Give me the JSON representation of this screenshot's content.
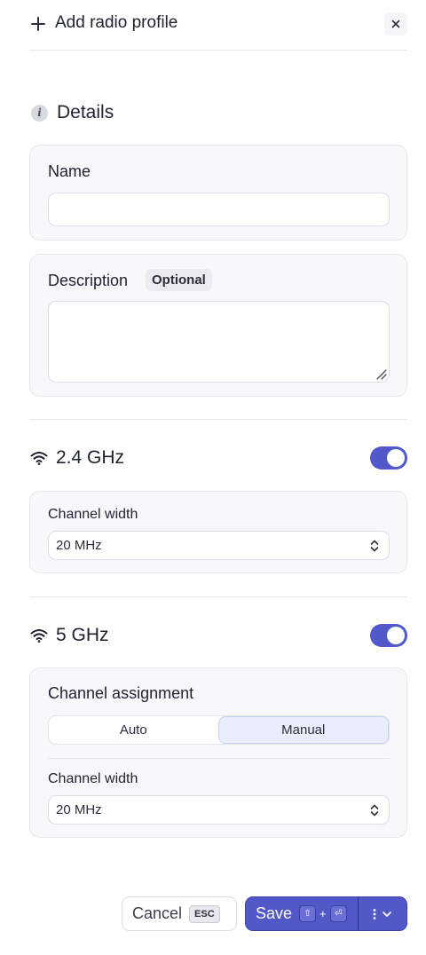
{
  "header": {
    "title": "Add radio profile"
  },
  "details": {
    "heading": "Details",
    "info_glyph": "i",
    "name_label": "Name",
    "name_value": "",
    "description_label": "Description",
    "optional_badge": "Optional",
    "description_value": ""
  },
  "band_24": {
    "heading": "2.4 GHz",
    "enabled": true,
    "channel_width_label": "Channel width",
    "channel_width_value": "20 MHz"
  },
  "band_5": {
    "heading": "5 GHz",
    "enabled": true,
    "channel_assignment_label": "Channel assignment",
    "assignment_options": [
      "Auto",
      "Manual"
    ],
    "assignment_selected": "Manual",
    "channel_width_label": "Channel width",
    "channel_width_value": "20 MHz"
  },
  "footer": {
    "cancel_label": "Cancel",
    "cancel_shortcut": "ESC",
    "save_label": "Save",
    "save_shortcut_1": "⇧",
    "save_shortcut_plus": "+",
    "save_shortcut_2": "⏎"
  },
  "colors": {
    "accent": "#5258c8",
    "card_bg": "#f8f8fb",
    "segment_active": "#eaeefc"
  },
  "icons": [
    "plus-icon",
    "close-icon",
    "info-icon",
    "wifi-icon",
    "chevron-updown-icon",
    "kebab-icon",
    "chevron-down-icon"
  ]
}
